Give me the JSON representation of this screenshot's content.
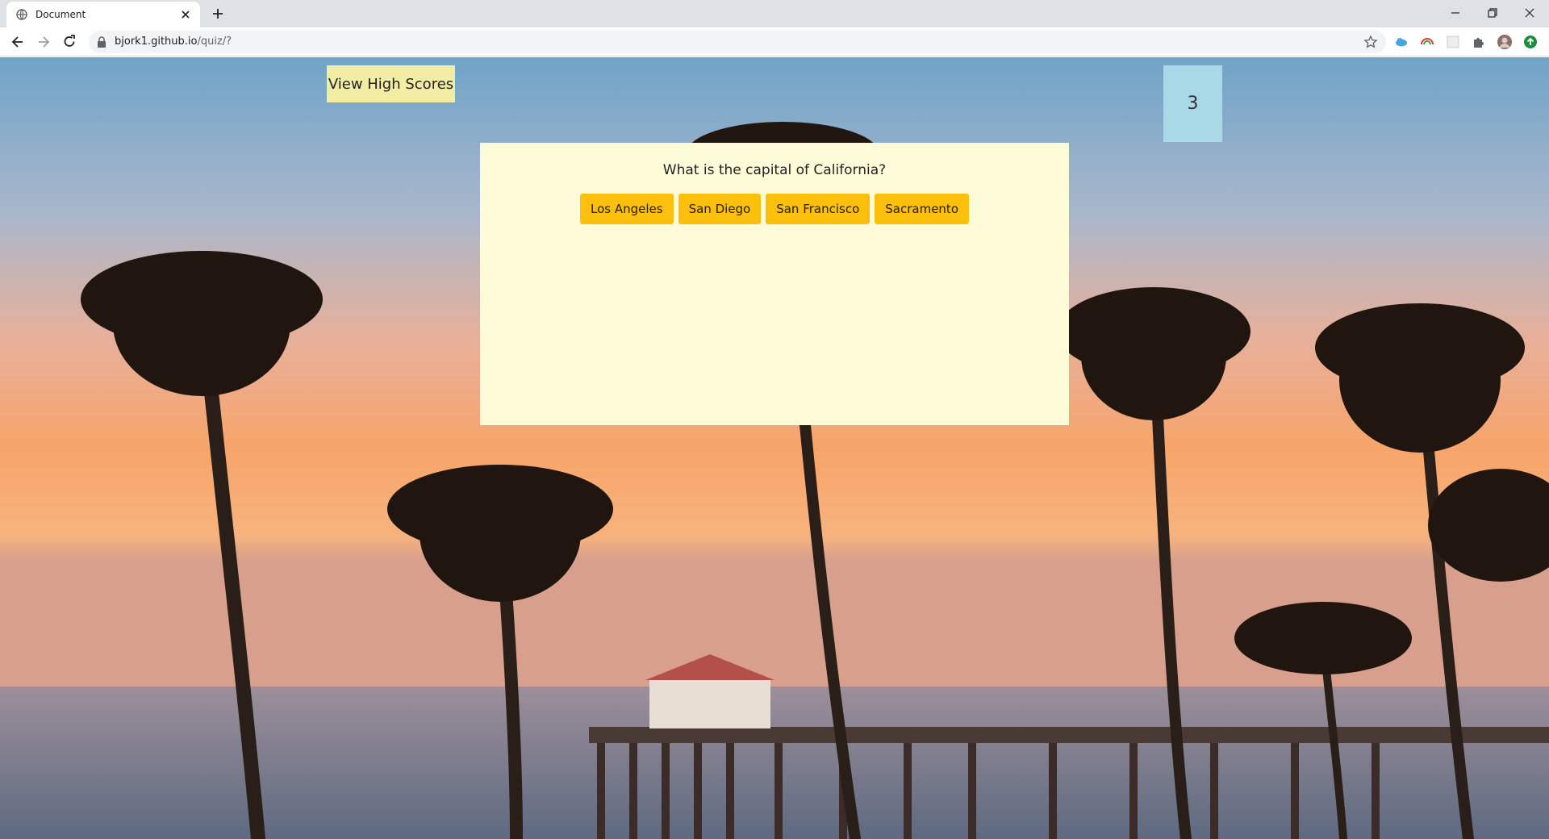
{
  "browser": {
    "tab_title": "Document",
    "url_host": "bjork1.github.io",
    "url_path": "/quiz/?"
  },
  "page": {
    "high_scores_label": "View High Scores",
    "timer_value": "3",
    "question": "What is the capital of California?",
    "answers": [
      "Los Angeles",
      "San Diego",
      "San Francisco",
      "Sacramento"
    ]
  },
  "colors": {
    "high_scores_bg": "#f2eca4",
    "timer_bg": "#a9d8e6",
    "card_bg": "#fefcd8",
    "answer_bg": "#fcbf0c"
  },
  "icons": {
    "favicon": "globe-icon",
    "back": "back-arrow-icon",
    "forward": "forward-arrow-icon",
    "reload": "reload-icon",
    "lock": "lock-icon",
    "bookmark": "star-icon",
    "extensions": "puzzle-icon"
  }
}
